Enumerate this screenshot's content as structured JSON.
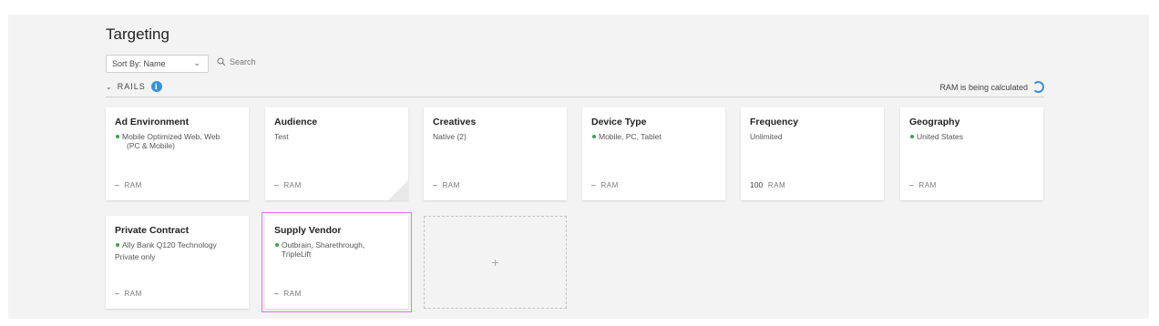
{
  "page": {
    "title": "Targeting"
  },
  "controls": {
    "sort_label": "Sort By: Name",
    "search_placeholder": "Search"
  },
  "rails": {
    "label": "RAILS",
    "ram_status": "RAM is being calculated"
  },
  "cards": [
    {
      "title": "Ad Environment",
      "lines": [
        "Mobile Optimized Web, Web",
        "(PC & Mobile)"
      ],
      "ram_value": "–",
      "ram_label": "RAM"
    },
    {
      "title": "Audience",
      "lines": [
        "Test"
      ],
      "ram_value": "–",
      "ram_label": "RAM"
    },
    {
      "title": "Creatives",
      "lines": [
        "Native (2)"
      ],
      "ram_value": "–",
      "ram_label": "RAM"
    },
    {
      "title": "Device Type",
      "lines": [
        "Mobile, PC, Tablet"
      ],
      "ram_value": "–",
      "ram_label": "RAM"
    },
    {
      "title": "Frequency",
      "lines": [
        "Unlimited"
      ],
      "ram_value": "100",
      "ram_label": "RAM"
    },
    {
      "title": "Geography",
      "lines": [
        "United States"
      ],
      "ram_value": "–",
      "ram_label": "RAM"
    },
    {
      "title": "Private Contract",
      "lines": [
        "Ally Bank Q120 Technology",
        "Private only"
      ],
      "ram_value": "–",
      "ram_label": "RAM"
    },
    {
      "title": "Supply Vendor",
      "lines": [
        "Outbrain, Sharethrough,",
        "TripleLift"
      ],
      "ram_value": "–",
      "ram_label": "RAM"
    }
  ],
  "add_card": {
    "symbol": "+"
  },
  "colors": {
    "accent": "#3a8fde",
    "status_dot": "#3fa04a",
    "selection": "#f06af2"
  },
  "icons": {
    "search": "search-icon",
    "info": "info-icon",
    "spinner": "loading-spinner-icon"
  }
}
